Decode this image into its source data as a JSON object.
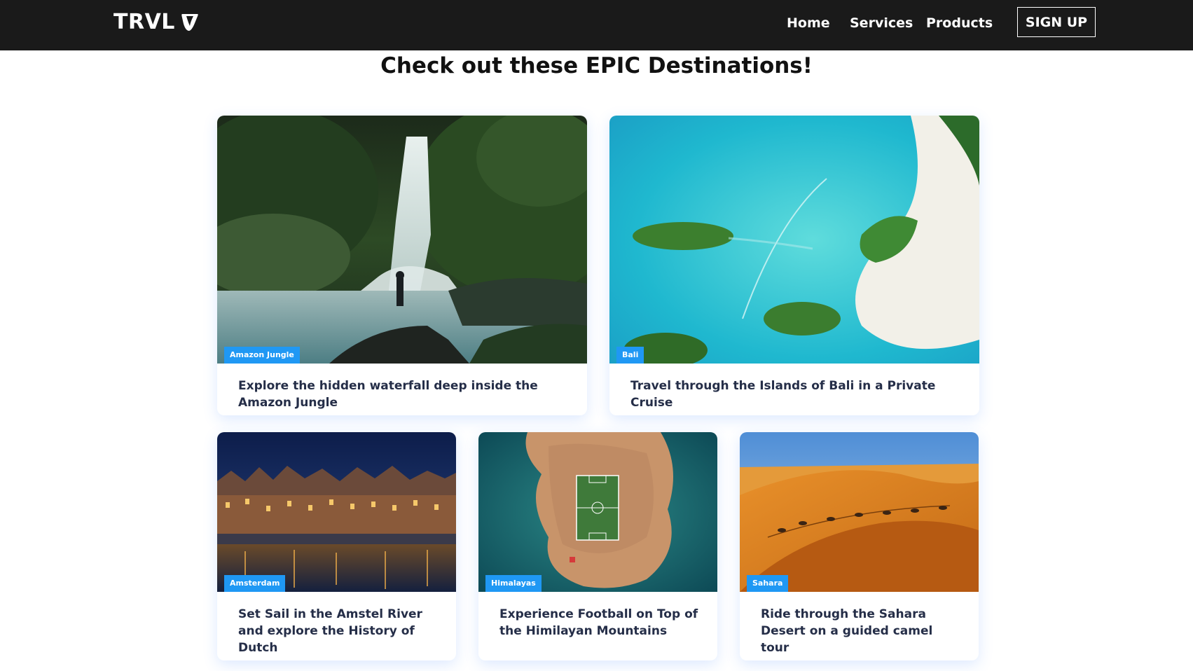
{
  "navbar": {
    "logo_text": "TRVL",
    "logo_icon": "typo3-logo-icon",
    "links": [
      "Home",
      "Services",
      "Products"
    ],
    "signup_label": "SIGN UP"
  },
  "page": {
    "title": "Check out these EPIC Destinations!"
  },
  "cards": [
    {
      "tag": "Amazon Jungle",
      "text": "Explore the hidden waterfall deep inside the Amazon Jungle",
      "image": "waterfall-jungle-image"
    },
    {
      "tag": "Bali",
      "text": "Travel through the Islands of Bali in a Private Cruise",
      "image": "bali-islands-aerial-image"
    },
    {
      "tag": "Amsterdam",
      "text": "Set Sail in the Amstel River and explore the History of Dutch",
      "image": "amsterdam-canal-night-image"
    },
    {
      "tag": "Himalayas",
      "text": "Experience Football on Top of the Himilayan Mountains",
      "image": "island-football-field-image"
    },
    {
      "tag": "Sahara",
      "text": "Ride through the Sahara Desert on a guided camel tour",
      "image": "sahara-dunes-camels-image"
    }
  ],
  "colors": {
    "navbar_bg": "#1a1a1a",
    "tag_bg": "#1f98f4",
    "card_text": "#252e48"
  }
}
